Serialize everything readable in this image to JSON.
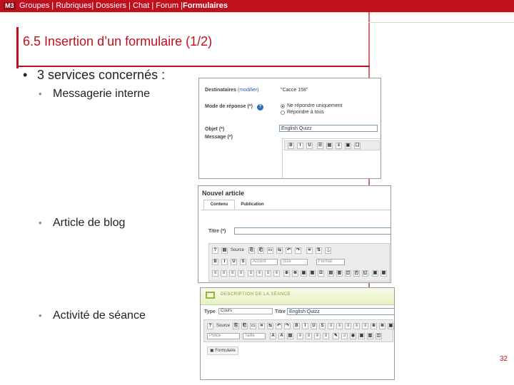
{
  "topbar": {
    "badge": "M3",
    "items": [
      {
        "label": "Groupes"
      },
      {
        "label": "Rubriques"
      },
      {
        "label": "Dossiers"
      },
      {
        "label": "Chat"
      },
      {
        "label": "Forum"
      },
      {
        "label": "Formulaires"
      }
    ]
  },
  "slide": {
    "title": "6.5 Insertion d’un formulaire (1/2)",
    "bullet": "3 services concernés :",
    "bullet_glyph": "•",
    "sub_glyph": "•",
    "subs": [
      {
        "label": "Messagerie interne"
      },
      {
        "label": "Article de blog"
      },
      {
        "label": "Activité de séance"
      }
    ],
    "page_number": "32"
  },
  "shot_messagerie": {
    "dest_label": "Destinataires",
    "dest_link": "(modifier)",
    "dest_value": "\"Cacce 158\"",
    "reply_label": "Mode de réponse (*)",
    "reply_options": [
      "Ne répondre uniquement",
      "Répondre à tous"
    ],
    "object_label": "Objet (*)",
    "object_value": "English Quizz",
    "message_label": "Message (*)",
    "toolbar": [
      "B",
      "I",
      "U",
      "☰",
      "▤",
      "⇩",
      "▣",
      "❏"
    ]
  },
  "shot_blog": {
    "header": "Nouvel article",
    "tabs": [
      "Contenu",
      "Publication"
    ],
    "title_label": "Titre (*)",
    "source_label": "Source",
    "selects": [
      "Accent",
      "Size",
      "Format"
    ],
    "toolbar_row1": [
      "?",
      "▤",
      "⎘",
      "⎗",
      "▭",
      "⇆",
      "↶",
      "↷",
      "⌗",
      "⇅",
      "⚓"
    ],
    "toolbar_row2": [
      "B",
      "I",
      "U",
      "S"
    ],
    "toolbar_row3": [
      "≡",
      "≡",
      "≡",
      "≡",
      "≡",
      "≡",
      "≡",
      "≡",
      "⊕",
      "⊗",
      "▣",
      "▦",
      "Ω",
      "▤",
      "▥",
      "◫",
      "◰",
      "◱",
      "▣",
      "▦"
    ]
  },
  "shot_seance": {
    "header": "DESCRIPTION DE LA SÉANCE",
    "type_label": "Type",
    "type_value": "Cours",
    "titre_label": "Titre",
    "titre_value": "English Quizz",
    "source_label": "Source",
    "police_label": "Police",
    "taille_label": "Taille",
    "insert_label": "Formulaire",
    "toolbar_row1": [
      "?",
      "⎘",
      "⎗",
      "▭",
      "⌗",
      "⇆",
      "↶",
      "↷",
      "B",
      "I",
      "U",
      "S",
      "≡",
      "≡",
      "≡",
      "≡",
      "≡",
      "⊕",
      "⊗",
      "▣",
      "♫",
      "▦",
      "Ω"
    ],
    "toolbar_row2": [
      "A",
      "A",
      "▤",
      "≡",
      "≡",
      "≡",
      "≡",
      "✎",
      "♫",
      "◉",
      "▣",
      "▥",
      "◫"
    ]
  }
}
